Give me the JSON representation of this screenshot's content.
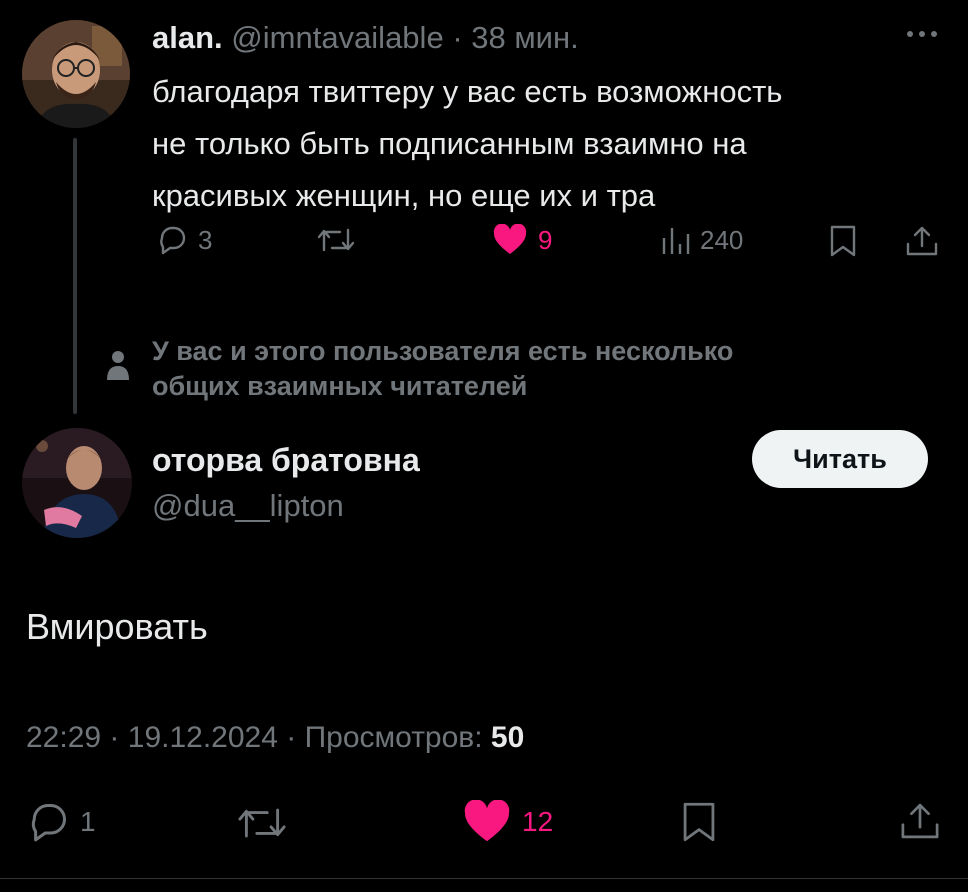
{
  "parent_tweet": {
    "author_name": "alan.",
    "handle": "@imntavailable",
    "separator": "·",
    "time_ago": "38 мин.",
    "text_lines": [
      "благодаря твиттеру у вас есть возможность",
      "не только быть подписанным взаимно на",
      "красивых женщин, но еще их и тра"
    ],
    "actions": {
      "reply_count": "3",
      "like_count": "9",
      "views_count": "240"
    }
  },
  "mutual_notice": {
    "lines": [
      "У вас и этого пользователя есть несколько",
      "общих взаимных читателей"
    ]
  },
  "reply_tweet": {
    "author_name": "оторва братовна",
    "handle": "@dua__lipton",
    "follow_label": "Читать",
    "text": "Вмировать",
    "meta": {
      "time": "22:29",
      "date": "19.12.2024",
      "views_label": "Просмотров:",
      "views_count": "50",
      "separator": "·"
    },
    "actions": {
      "reply_count": "1",
      "like_count": "12"
    }
  },
  "colors": {
    "background": "#000000",
    "text": "#e7e9ea",
    "muted": "#71767b",
    "like": "#f91880",
    "follow_button_bg": "#eff3f4"
  },
  "icons": [
    "more-icon",
    "reply-icon",
    "retweet-icon",
    "heart-icon",
    "views-icon",
    "bookmark-icon",
    "share-icon",
    "person-icon"
  ]
}
